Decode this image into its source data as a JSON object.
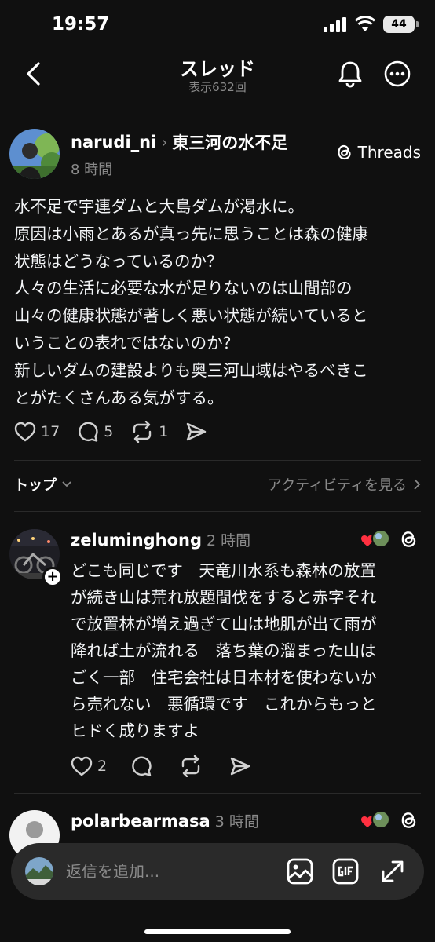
{
  "status_bar": {
    "time": "19:57",
    "battery": "44"
  },
  "header": {
    "title": "スレッド",
    "views": "表示632回"
  },
  "post": {
    "username": "narudi_ni",
    "topic": "東三河の水不足",
    "time": "8 時間",
    "threads_label": "Threads",
    "body_lines": [
      "水不足で宇連ダムと大島ダムが渇水に。",
      "原因は小雨とあるが真っ先に思うことは森の健康",
      "状態はどうなっているのか？",
      "人々の生活に必要な水が足りないのは山間部の",
      "山々の健康状態が著しく悪い状態が続いていると",
      "いうことの表れではないのか？",
      "新しいダムの建設よりも奥三河山域はやるべきこ",
      "とがたくさんある気がする。"
    ],
    "likes": "17",
    "comments": "5",
    "reposts": "1"
  },
  "sort": {
    "label": "トップ",
    "activity_link": "アクティビティを見る"
  },
  "replies": [
    {
      "username": "zeluminghong",
      "time": "2 時間",
      "body_lines": [
        "どこも同じです　天竜川水系も森林の放置",
        "が続き山は荒れ放題間伐をすると赤字それ",
        "で放置林が増え過ぎて山は地肌が出て雨が",
        "降れば土が流れる　落ち葉の溜まった山は",
        "ごく一部　住宅会社は日本材を使わないか",
        "ら売れない　悪循環です　これからもっと",
        "ヒドく成りますよ"
      ],
      "likes": "2"
    },
    {
      "username": "polarbearmasa",
      "time": "3 時間"
    }
  ],
  "composer": {
    "placeholder": "返信を追加..."
  },
  "colors": {
    "background": "#101010",
    "text": "#f3f5f7",
    "secondary": "#8a8a8a",
    "heart": "#ff3040"
  },
  "icons": [
    "back-icon",
    "bell-icon",
    "more-icon",
    "threads-logo-icon",
    "heart-icon",
    "comment-icon",
    "repost-icon",
    "share-icon",
    "image-icon",
    "gif-icon",
    "expand-icon"
  ]
}
